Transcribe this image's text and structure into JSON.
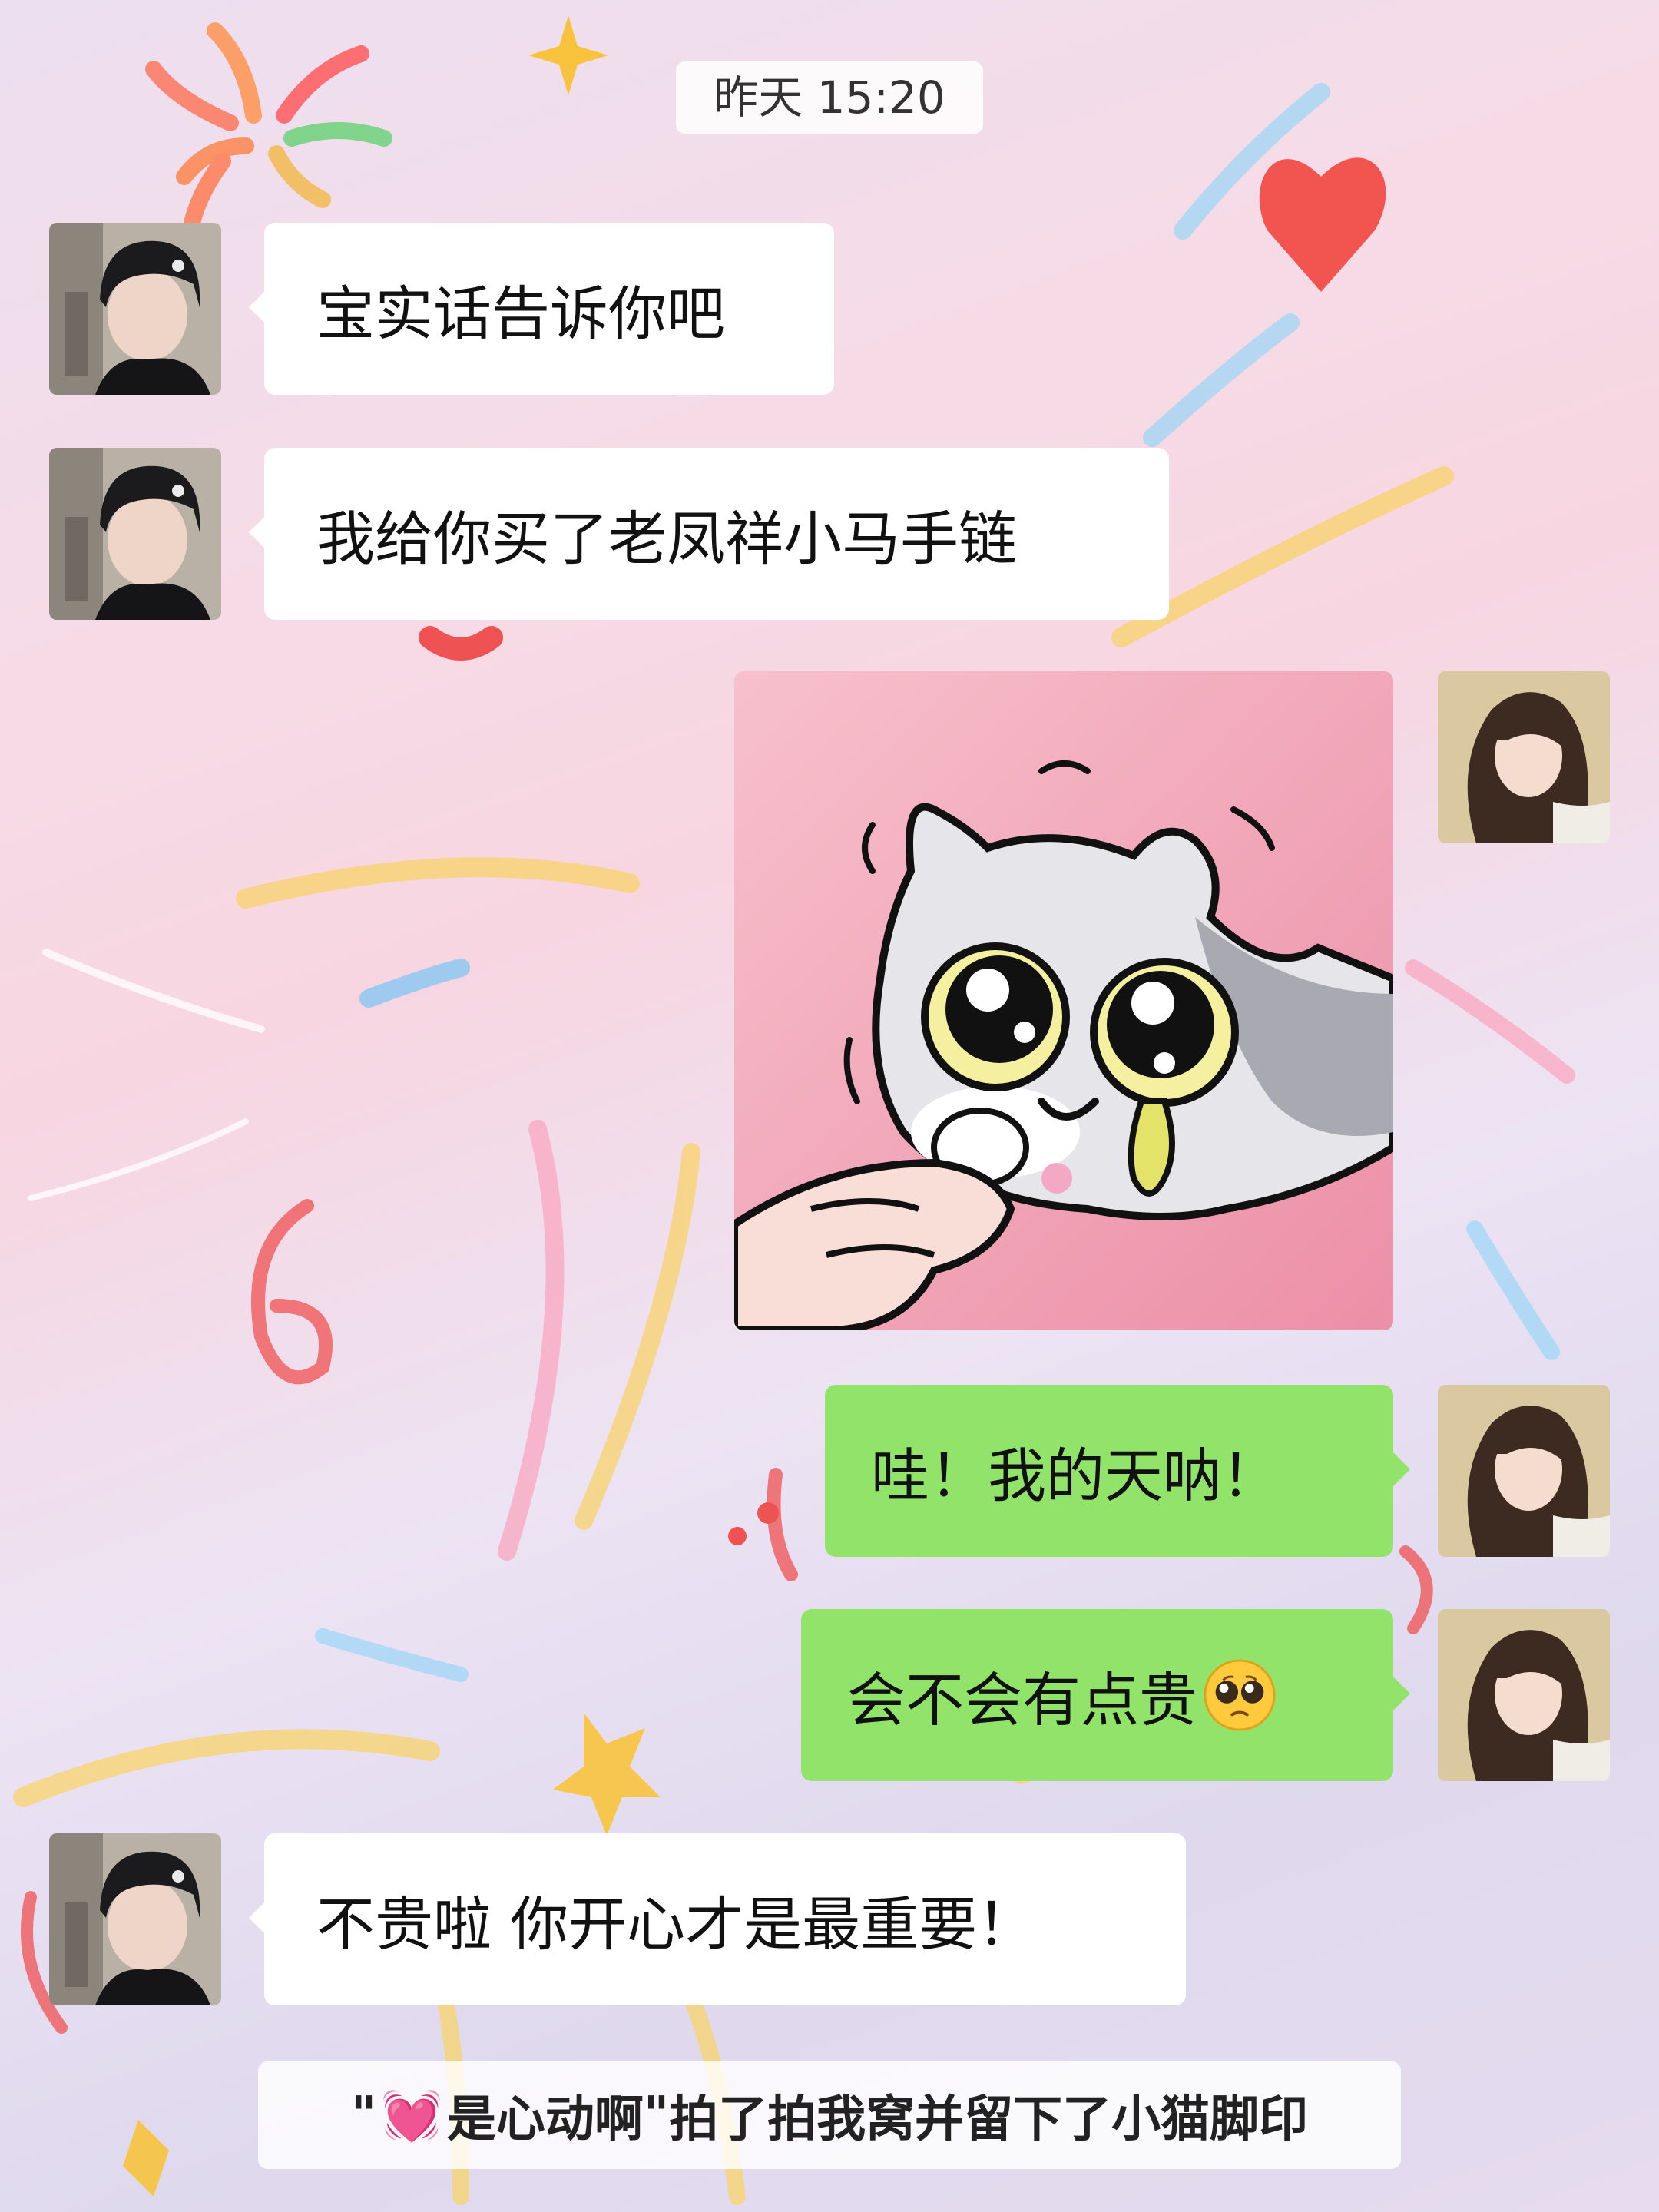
{
  "chat": {
    "timestamp": "昨天 15:20",
    "messages": [
      {
        "sender": "him",
        "type": "text",
        "text": "宝实话告诉你吧"
      },
      {
        "sender": "him",
        "type": "text",
        "text": "我给你买了老凤祥小马手链"
      },
      {
        "sender": "me",
        "type": "sticker",
        "sticker": "crying-cat-sticker"
      },
      {
        "sender": "me",
        "type": "text",
        "text": "哇！我的天呐！"
      },
      {
        "sender": "me",
        "type": "text",
        "text": "会不会有点贵",
        "emoji": "pleading-face-emoji"
      },
      {
        "sender": "him",
        "type": "text",
        "text": "不贵啦 你开心才是最重要！"
      }
    ],
    "pat_notice": {
      "quote_open": "\"",
      "heart": "💓",
      "name": "是心动啊",
      "quote_close": "\"",
      "action": " 拍了拍我窝并留下了小猫脚印"
    }
  },
  "colors": {
    "my_bubble": "#92e36a",
    "their_bubble": "#ffffff"
  }
}
